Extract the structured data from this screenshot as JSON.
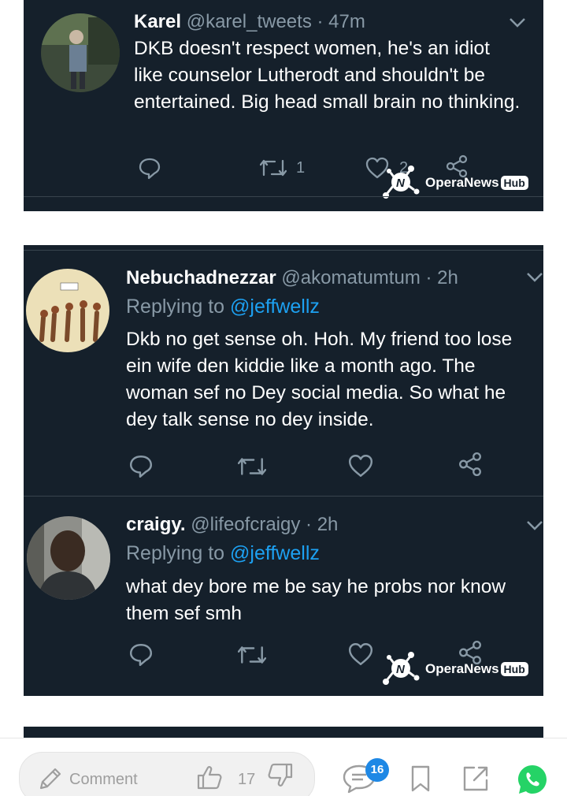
{
  "tweets": [
    {
      "name": "Karel",
      "handle": "@karel_tweets",
      "time": "· 47m",
      "text": "DKB doesn't respect women, he's an idiot like counselor Lutherodt and shouldn't be entertained. Big head small brain no thinking.",
      "retweets": "1",
      "likes": "2"
    },
    {
      "name": "Nebuchadnezzar",
      "handle": "@akomatumtum",
      "time": "· 2h",
      "replying_label": "Replying to",
      "replying_handle": "@jeffwellz",
      "text": "Dkb no get sense oh. Hoh. My friend too lose ein wife den kiddie like a month ago. The woman sef no Dey social media. So what he dey talk sense no dey inside."
    },
    {
      "name": "craigy.",
      "handle": "@lifeofcraigy",
      "time": "· 2h",
      "replying_label": "Replying to",
      "replying_handle": "@jeffwellz",
      "text": "what dey bore me be say he probs nor know them sef smh"
    }
  ],
  "watermark": {
    "brand": "OperaNews",
    "hub": "Hub"
  },
  "bottom_bar": {
    "comment_placeholder": "Comment",
    "vote_count": "17",
    "comments_badge": "16"
  },
  "colors": {
    "background": "#15202b",
    "accent": "#1da1f2",
    "muted": "#8899a6",
    "whatsapp": "#25d366",
    "badge": "#1e88e5"
  },
  "icons": [
    "reply-icon",
    "retweet-icon",
    "like-icon",
    "share-icon",
    "chevron-down-icon",
    "pencil-icon",
    "thumbs-up-icon",
    "thumbs-down-icon",
    "comments-icon",
    "bookmark-icon",
    "external-share-icon",
    "whatsapp-icon"
  ]
}
